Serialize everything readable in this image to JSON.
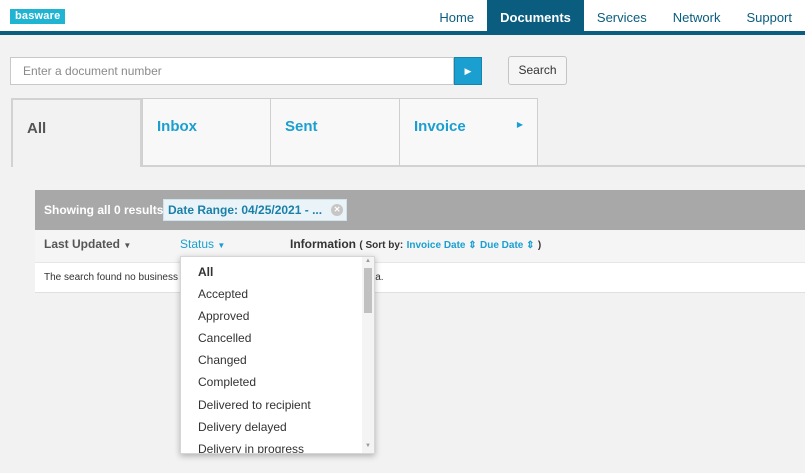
{
  "header": {
    "logo": "basware",
    "nav": [
      "Home",
      "Documents",
      "Services",
      "Network",
      "Support"
    ],
    "active_nav": "Documents"
  },
  "search": {
    "placeholder": "Enter a document number",
    "value": "",
    "go_icon": "caret-right-icon",
    "button_label": "Search"
  },
  "tabs": [
    {
      "label": "All",
      "active": true
    },
    {
      "label": "Inbox",
      "active": false
    },
    {
      "label": "Sent",
      "active": false
    },
    {
      "label": "Invoice",
      "active": false,
      "icon": "caret-right-icon"
    }
  ],
  "results": {
    "summary": "Showing all 0 results",
    "filter_chip": "Date Range: 04/25/2021 - ...",
    "chip_close_icon": "close-icon"
  },
  "columns": {
    "last_updated": "Last Updated",
    "status": "Status",
    "information": "Information",
    "sort_prefix": "( Sort by:",
    "sort_invoice_date": "Invoice Date",
    "sort_due_date": "Due Date",
    "sort_suffix": ")"
  },
  "no_results": {
    "text_start": "The search found no business",
    "text_end": "ia."
  },
  "status_dropdown": {
    "selected": "All",
    "options": [
      "All",
      "Accepted",
      "Approved",
      "Cancelled",
      "Changed",
      "Completed",
      "Delivered to recipient",
      "Delivery delayed",
      "Delivery in progress"
    ]
  },
  "colors": {
    "brand_teal": "#1fb4d2",
    "nav_dark": "#0a5d7f",
    "link_blue": "#1a9fd0",
    "results_bar_gray": "#a8a8a8"
  }
}
